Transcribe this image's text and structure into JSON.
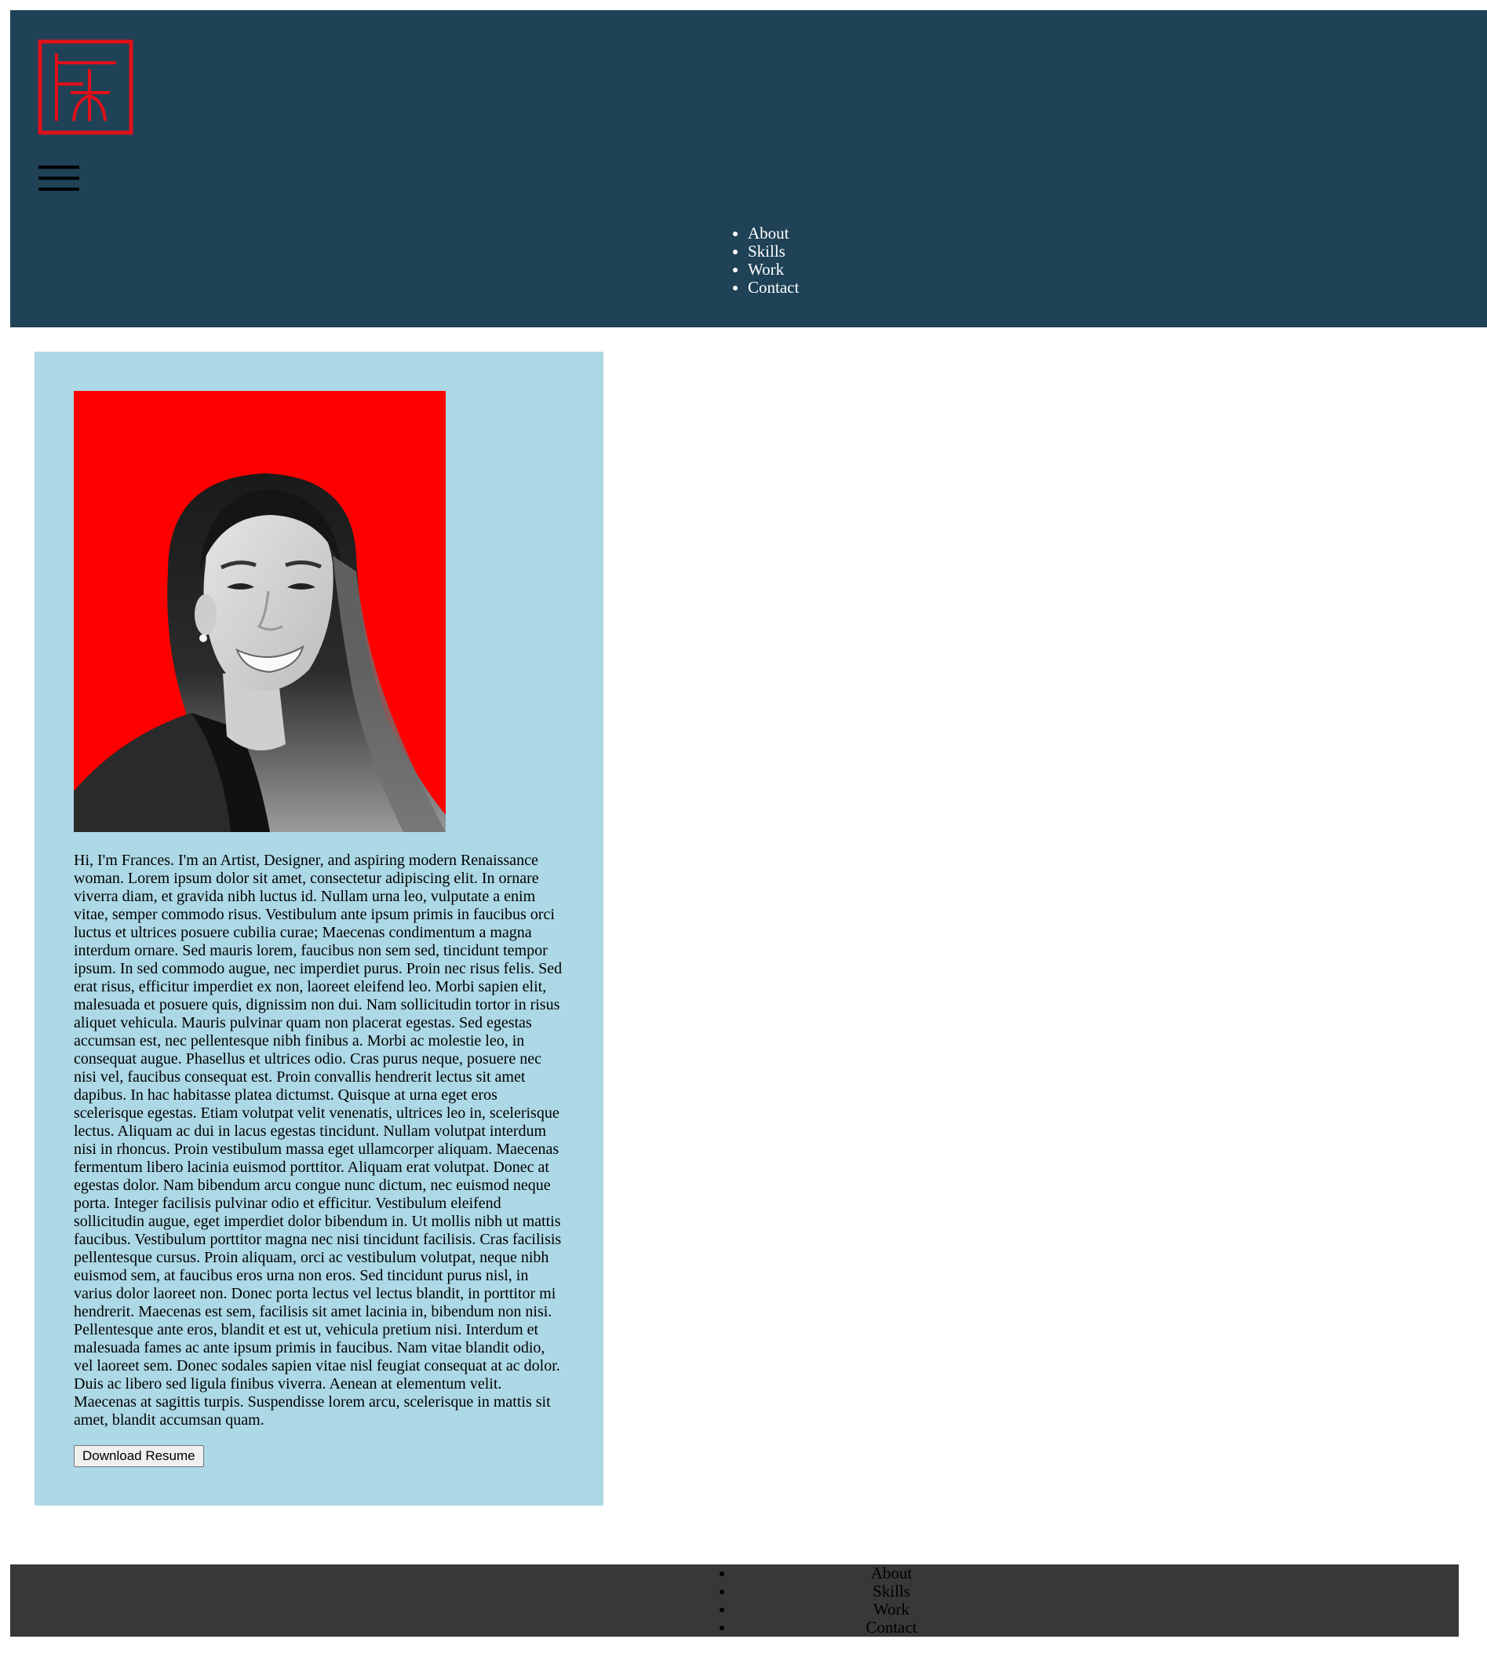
{
  "header": {
    "nav": [
      "About",
      "Skills",
      "Work",
      "Contact"
    ]
  },
  "about": {
    "bio": "Hi, I'm Frances. I'm an Artist, Designer, and aspiring modern Renaissance woman. Lorem ipsum dolor sit amet, consectetur adipiscing elit. In ornare viverra diam, et gravida nibh luctus id. Nullam urna leo, vulputate a enim vitae, semper commodo risus. Vestibulum ante ipsum primis in faucibus orci luctus et ultrices posuere cubilia curae; Maecenas condimentum a magna interdum ornare. Sed mauris lorem, faucibus non sem sed, tincidunt tempor ipsum. In sed commodo augue, nec imperdiet purus. Proin nec risus felis. Sed erat risus, efficitur imperdiet ex non, laoreet eleifend leo. Morbi sapien elit, malesuada et posuere quis, dignissim non dui. Nam sollicitudin tortor in risus aliquet vehicula. Mauris pulvinar quam non placerat egestas. Sed egestas accumsan est, nec pellentesque nibh finibus a. Morbi ac molestie leo, in consequat augue. Phasellus et ultrices odio. Cras purus neque, posuere nec nisi vel, faucibus consequat est. Proin convallis hendrerit lectus sit amet dapibus. In hac habitasse platea dictumst. Quisque at urna eget eros scelerisque egestas. Etiam volutpat velit venenatis, ultrices leo in, scelerisque lectus. Aliquam ac dui in lacus egestas tincidunt. Nullam volutpat interdum nisi in rhoncus. Proin vestibulum massa eget ullamcorper aliquam. Maecenas fermentum libero lacinia euismod porttitor. Aliquam erat volutpat. Donec at egestas dolor. Nam bibendum arcu congue nunc dictum, nec euismod neque porta. Integer facilisis pulvinar odio et efficitur. Vestibulum eleifend sollicitudin augue, eget imperdiet dolor bibendum in. Ut mollis nibh ut mattis faucibus. Vestibulum porttitor magna nec nisi tincidunt facilisis. Cras facilisis pellentesque cursus. Proin aliquam, orci ac vestibulum volutpat, neque nibh euismod sem, at faucibus eros urna non eros. Sed tincidunt purus nisl, in varius dolor laoreet non. Donec porta lectus vel lectus blandit, in porttitor mi hendrerit. Maecenas est sem, facilisis sit amet lacinia in, bibendum non nisi. Pellentesque ante eros, blandit et est ut, vehicula pretium nisi. Interdum et malesuada fames ac ante ipsum primis in faucibus. Nam vitae blandit odio, vel laoreet sem. Donec sodales sapien vitae nisl feugiat consequat at ac dolor. Duis ac libero sed ligula finibus viverra. Aenean at elementum velit. Maecenas at sagittis turpis. Suspendisse lorem arcu, scelerisque in mattis sit amet, blandit accumsan quam.",
    "download_label": "Download Resume"
  },
  "footer": {
    "nav": [
      "About",
      "Skills",
      "Work",
      "Contact"
    ]
  },
  "colors": {
    "header_bg": "#1f4257",
    "logo_red": "#e0101a",
    "card_bg": "#add8e6",
    "portrait_bg": "#ff0000",
    "footer_bg": "#383838"
  },
  "icons": {
    "logo": "monogram-seal-icon",
    "menu": "hamburger-menu-icon"
  }
}
